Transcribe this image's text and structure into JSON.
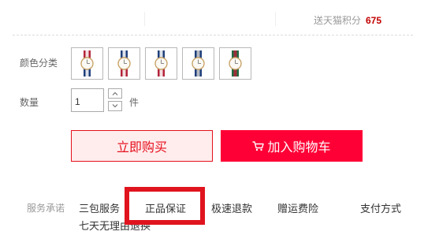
{
  "stats": {
    "points_label": "送天猫积分",
    "points_value": "675"
  },
  "color": {
    "label": "颜色分类",
    "options": [
      {
        "name": "swatch-1",
        "strap_colors": [
          "#b3243a",
          "#ffffff",
          "#1f3f7a"
        ]
      },
      {
        "name": "swatch-2",
        "strap_colors": [
          "#1f3f7a",
          "#ffffff",
          "#b3243a"
        ]
      },
      {
        "name": "swatch-3",
        "strap_colors": [
          "#1f3f7a",
          "#ffffff",
          "#b3243a"
        ]
      },
      {
        "name": "swatch-4",
        "strap_colors": [
          "#1f3f7a",
          "#cfcfcf",
          "#1f3f7a"
        ]
      },
      {
        "name": "swatch-5",
        "strap_colors": [
          "#1f6b3f",
          "#b3243a",
          "#1f6b3f"
        ]
      }
    ]
  },
  "quantity": {
    "label": "数量",
    "value": "1",
    "unit": "件"
  },
  "actions": {
    "buy_now": "立即购买",
    "add_to_cart": "加入购物车"
  },
  "services": {
    "label": "服务承诺",
    "items": [
      "三包服务",
      "正品保证",
      "极速退款",
      "赠运费险",
      "支付方式",
      "七天无理由退换"
    ]
  },
  "colors": {
    "accent": "#ff0036",
    "accent_dark": "#e5101d",
    "points": "#c40000"
  }
}
